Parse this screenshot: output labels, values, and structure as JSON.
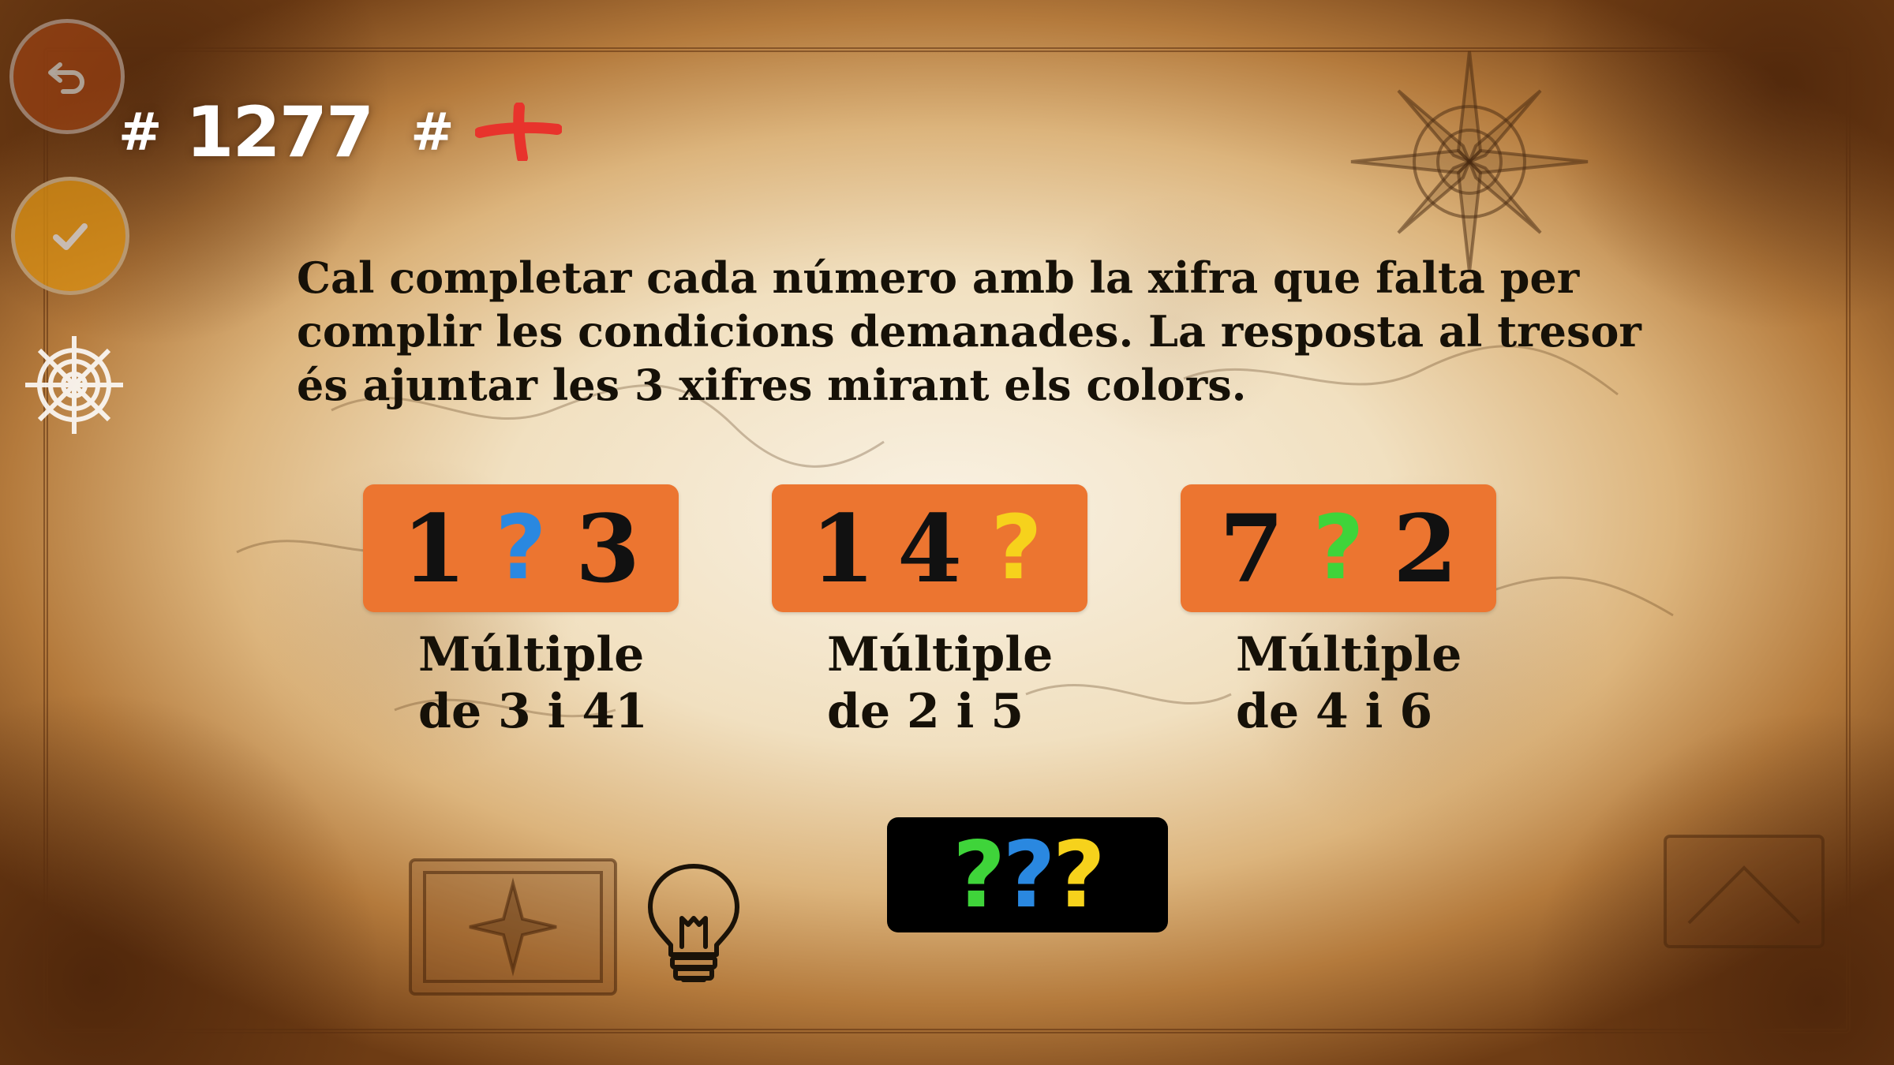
{
  "level": {
    "prefix": "#",
    "number": "1277",
    "suffix": "#"
  },
  "buttons": {
    "back_icon": "undo-arrow-icon",
    "check_icon": "checkmark-icon",
    "settings_icon": "ship-wheel-icon",
    "hint_icon": "lightbulb-icon",
    "life_icon": "red-cross-icon"
  },
  "instructions": "Cal completar cada número amb la xifra que falta per complir les condicions demanades. La resposta al tresor és ajuntar les 3 xifres mirant els colors.",
  "puzzles": [
    {
      "digits": [
        "1",
        "?",
        "3"
      ],
      "missing_color": "#2a88e0",
      "condition_line1": "Múltiple",
      "condition_line2": "de 3 i 41"
    },
    {
      "digits": [
        "1",
        "4",
        "?"
      ],
      "missing_color": "#f6d21c",
      "condition_line1": "Múltiple",
      "condition_line2": "de 2 i 5"
    },
    {
      "digits": [
        "7",
        "?",
        "2"
      ],
      "missing_color": "#3fd43a",
      "condition_line1": "Múltiple",
      "condition_line2": "de 4 i 6"
    }
  ],
  "answer": {
    "slots": [
      "?",
      "?",
      "?"
    ],
    "slot_colors": [
      "#3fd43a",
      "#2a88e0",
      "#f6d21c"
    ]
  },
  "colors": {
    "box_orange": "#ec7530",
    "answer_bg": "#000000",
    "text_dark": "#161108"
  }
}
